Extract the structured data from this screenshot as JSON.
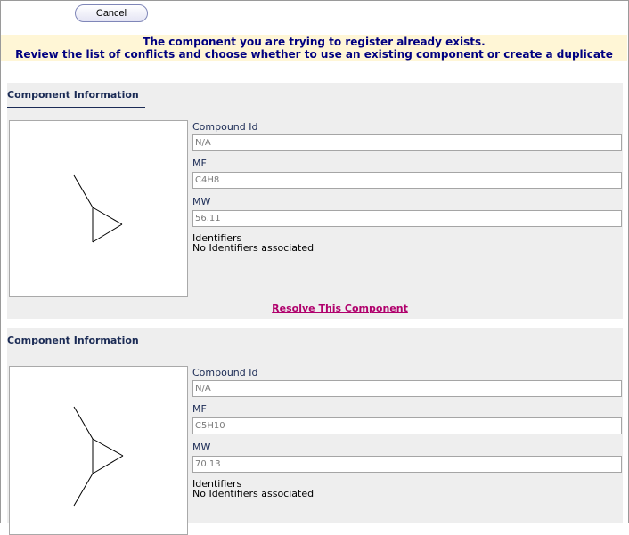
{
  "toolbar": {
    "cancel_label": "Cancel"
  },
  "banner": {
    "line1": "The component you are trying to register already exists.",
    "line2": "Review the list of conflicts and choose whether to use an existing component or create a duplicate"
  },
  "components": [
    {
      "title": "Component Information",
      "compound_id_label": "Compound Id",
      "compound_id": "N/A",
      "mf_label": "MF",
      "mf": "C4H8",
      "mw_label": "MW",
      "mw": "56.11",
      "identifiers_label": "Identifiers",
      "identifiers_value": "No Identifiers associated",
      "resolve_label": "Resolve This Component"
    },
    {
      "title": "Component Information",
      "compound_id_label": "Compound Id",
      "compound_id": "N/A",
      "mf_label": "MF",
      "mf": "C5H10",
      "mw_label": "MW",
      "mw": "70.13",
      "identifiers_label": "Identifiers",
      "identifiers_value": "No Identifiers associated"
    }
  ],
  "colors": {
    "banner_bg": "#fff6d6",
    "banner_text": "#000080",
    "link": "#b0006c",
    "panel_bg": "#eeeeee"
  }
}
